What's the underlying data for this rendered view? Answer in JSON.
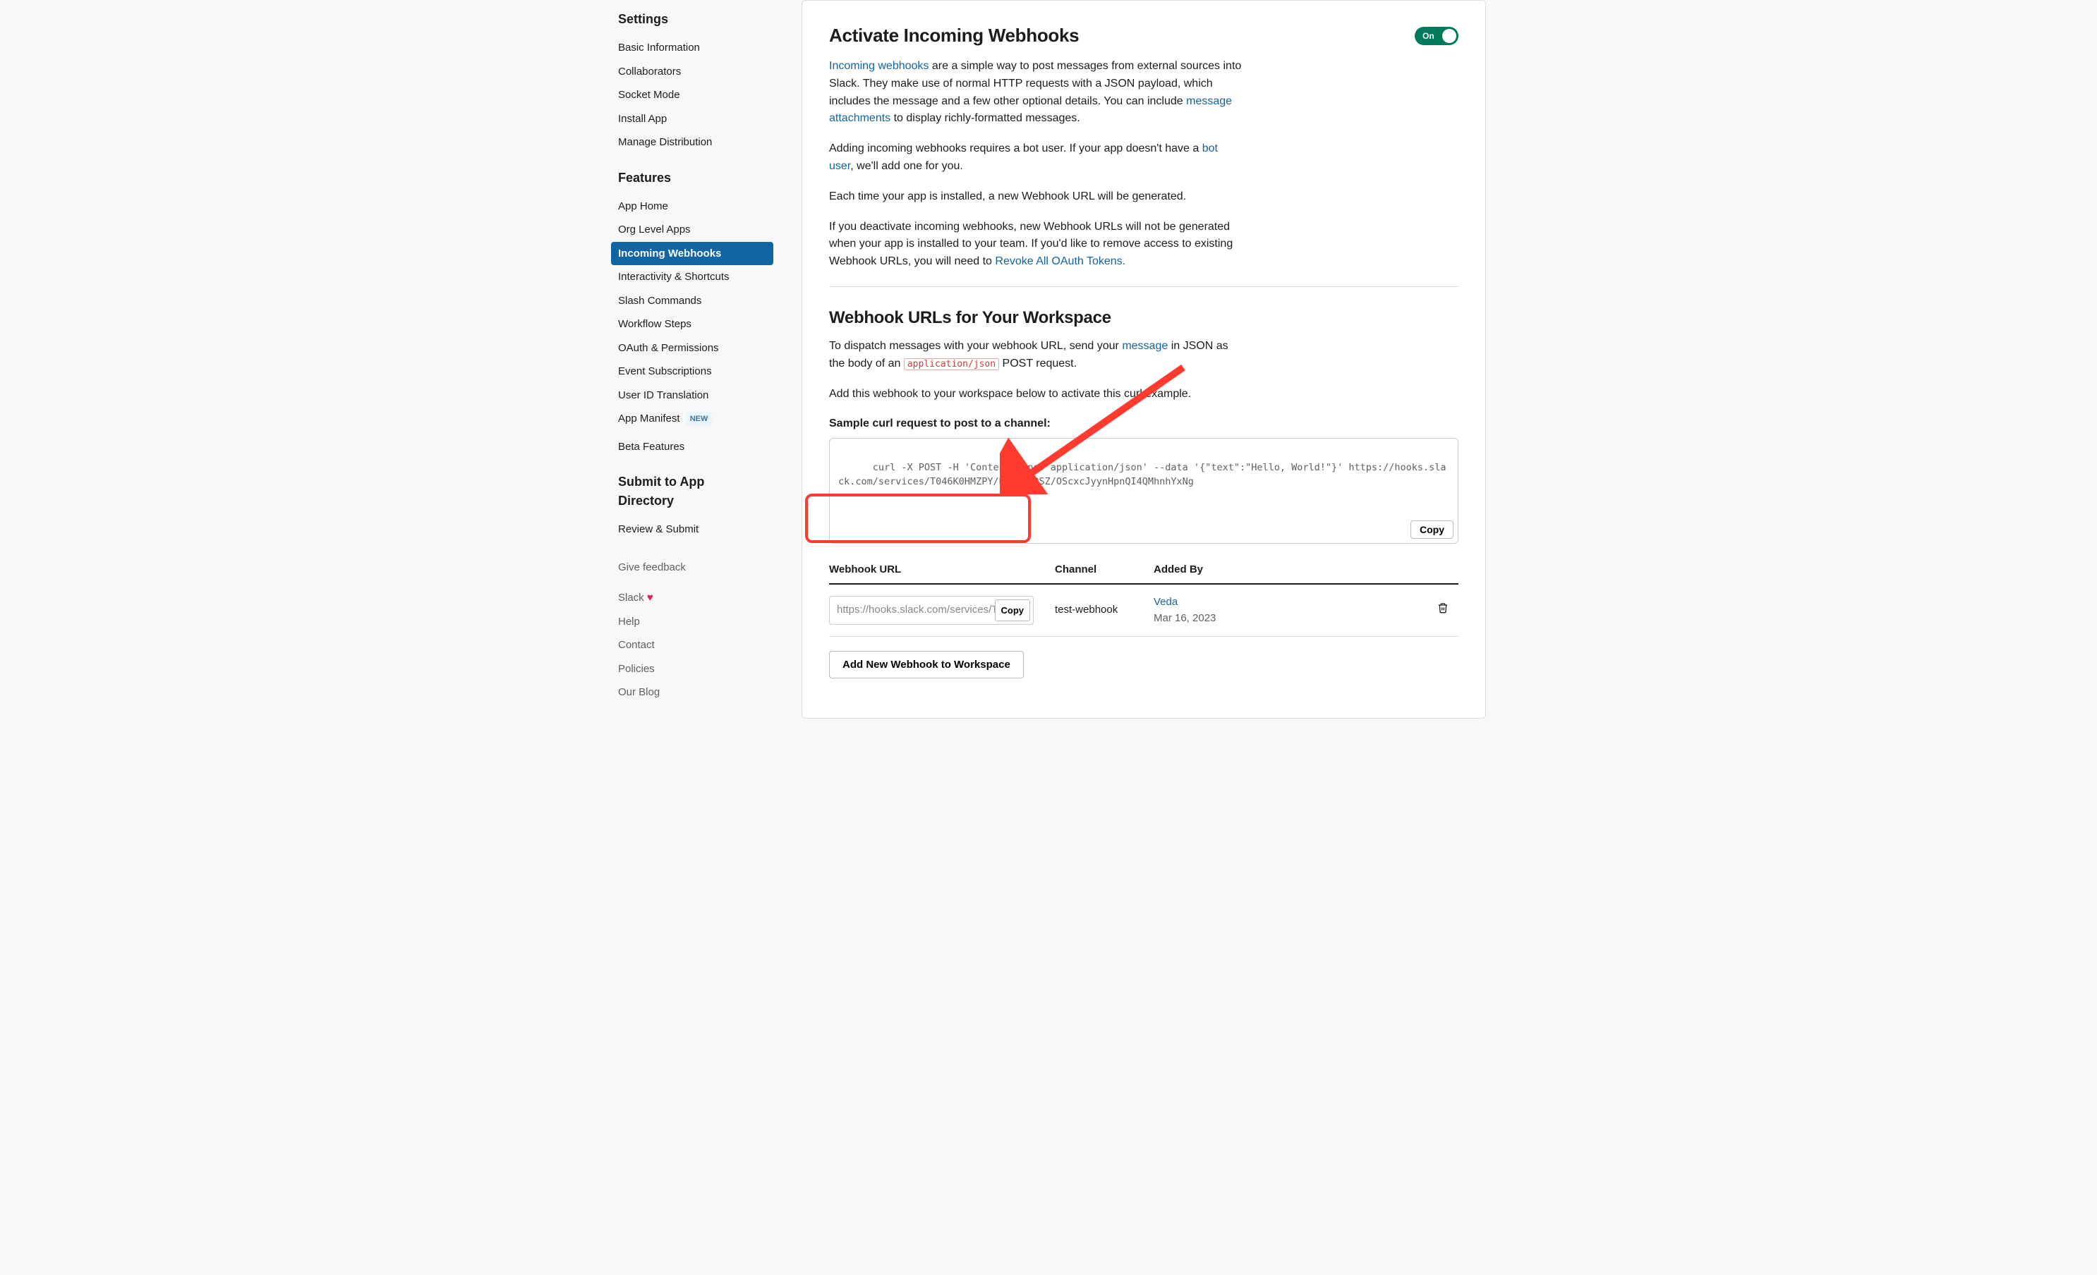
{
  "sidebar": {
    "settings_title": "Settings",
    "settings_items": [
      "Basic Information",
      "Collaborators",
      "Socket Mode",
      "Install App",
      "Manage Distribution"
    ],
    "features_title": "Features",
    "features_items": [
      "App Home",
      "Org Level Apps",
      "Incoming Webhooks",
      "Interactivity & Shortcuts",
      "Slash Commands",
      "Workflow Steps",
      "OAuth & Permissions",
      "Event Subscriptions",
      "User ID Translation",
      "App Manifest",
      "Beta Features"
    ],
    "features_active_index": 2,
    "app_manifest_badge": "NEW",
    "submit_title": "Submit to App Directory",
    "submit_items": [
      "Review & Submit"
    ],
    "footer_items": [
      "Give feedback"
    ],
    "slack_link": "Slack",
    "heart_glyph": "♥",
    "footer_links": [
      "Help",
      "Contact",
      "Policies",
      "Our Blog"
    ]
  },
  "main": {
    "activate_title": "Activate Incoming Webhooks",
    "toggle_label": "On",
    "para1_a": "Incoming webhooks",
    "para1_b": " are a simple way to post messages from external sources into Slack. They make use of normal HTTP requests with a JSON payload, which includes the message and a few other optional details. You can include ",
    "para1_c": "message attachments",
    "para1_d": " to display richly-formatted messages.",
    "para2_a": "Adding incoming webhooks requires a bot user. If your app doesn't have a ",
    "para2_b": "bot user",
    "para2_c": ", we'll add one for you.",
    "para3": "Each time your app is installed, a new Webhook URL will be generated.",
    "para4_a": "If you deactivate incoming webhooks, new Webhook URLs will not be generated when your app is installed to your team. If you'd like to remove access to existing Webhook URLs, you will need to ",
    "para4_b": "Revoke All OAuth Tokens.",
    "urls_title": "Webhook URLs for Your Workspace",
    "dispatch_a": "To dispatch messages with your webhook URL, send your ",
    "dispatch_b": "message",
    "dispatch_c": " in JSON as the body of an ",
    "dispatch_code": "application/json",
    "dispatch_d": " POST request.",
    "activate_hint": "Add this webhook to your workspace below to activate this curl example.",
    "sample_label": "Sample curl request to post to a channel:",
    "curl_code": "curl -X POST -H 'Content-type: application/json' --data '{\"text\":\"Hello, World!\"}' https://hooks.slack.com/services/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",
    "copy_label": "Copy",
    "table": {
      "col_url": "Webhook URL",
      "col_channel": "Channel",
      "col_added": "Added By",
      "row": {
        "url_display": "https://hooks.slack.com/services/T0",
        "channel": "test-webhook",
        "added_name": "Veda",
        "added_date": "Mar 16, 2023"
      }
    },
    "add_button": "Add New Webhook to Workspace"
  }
}
